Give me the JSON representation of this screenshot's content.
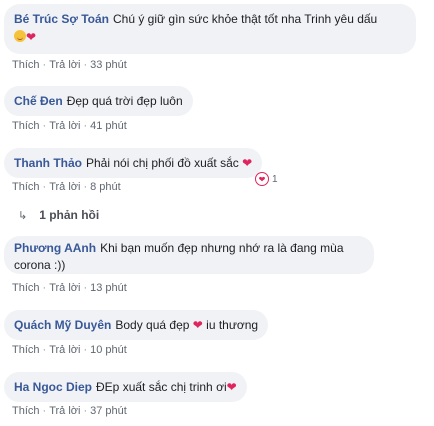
{
  "labels": {
    "like": "Thích",
    "reply": "Trả lời",
    "sep": "·"
  },
  "comments": [
    {
      "author": "Bé Trúc Sợ Toán",
      "text": "Chú ý giữ gìn sức khỏe thật tốt nha Trinh yêu dấu",
      "time": "33 phút",
      "emoji": "😍❤️"
    },
    {
      "author": "Chế Đen",
      "text": "Đẹp quá trời đẹp luôn",
      "time": "41 phút"
    },
    {
      "author": "Thanh Thảo",
      "text": "Phải nói chị phối đồ xuất sắc",
      "heart": "❤",
      "time": "8 phút",
      "reaction_count": "1"
    },
    {
      "author": "Phương AAnh",
      "text": "Khi bạn muốn đẹp nhưng nhớ ra là đang mùa corona :))",
      "time": "13 phút"
    },
    {
      "author": "Quách Mỹ Duyên",
      "text": "Body quá đẹp",
      "heart": "❤",
      "text2": "iu thương",
      "time": "10 phút"
    },
    {
      "author": "Ha Ngoc Diep",
      "text": "ĐEp xuất sắc chị trinh ơi",
      "heart": "❤",
      "time": "37 phút"
    }
  ],
  "replies_link": {
    "icon": "reply-arrow-icon",
    "label": "1 phản hồi"
  },
  "colors": {
    "author": "#385898",
    "bubble": "#f0f2f5",
    "heart": "#e0245e",
    "meta": "#606770"
  }
}
